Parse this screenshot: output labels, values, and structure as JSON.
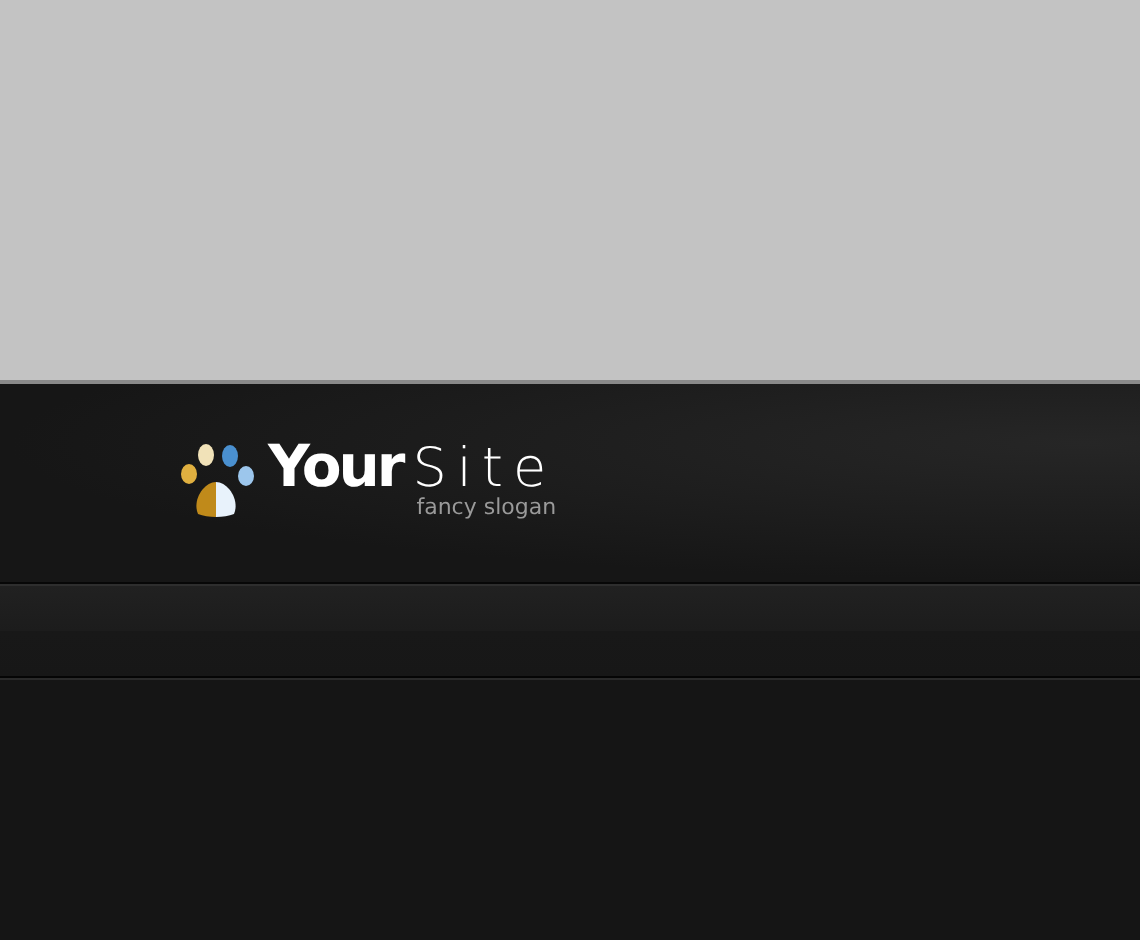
{
  "header": {
    "logo": {
      "words": [
        "Your",
        "Site"
      ],
      "slogan": "fancy slogan"
    }
  }
}
